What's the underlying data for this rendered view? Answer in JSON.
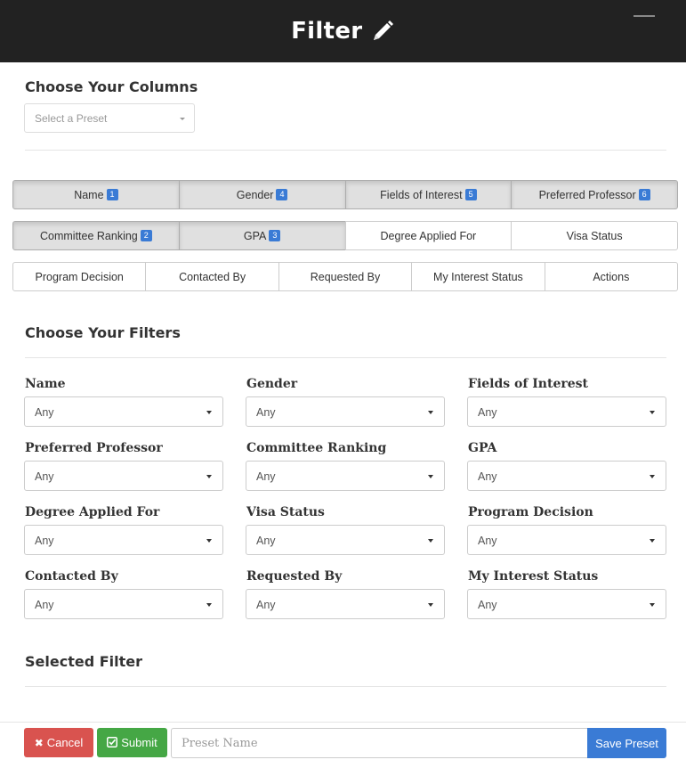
{
  "header": {
    "title": "Filter",
    "edit_icon": "pencil-icon",
    "menu_icon": "hamburger-icon"
  },
  "columns_section": {
    "title": "Choose Your Columns",
    "preset_select": {
      "placeholder": "Select a Preset"
    },
    "rows": [
      [
        {
          "label": "Name",
          "badge": "1",
          "active": true
        },
        {
          "label": "Gender",
          "badge": "4",
          "active": true
        },
        {
          "label": "Fields of Interest",
          "badge": "5",
          "active": true
        },
        {
          "label": "Preferred Professor",
          "badge": "6",
          "active": true
        }
      ],
      [
        {
          "label": "Committee Ranking",
          "badge": "2",
          "active": true
        },
        {
          "label": "GPA",
          "badge": "3",
          "active": true
        },
        {
          "label": "Degree Applied For",
          "badge": "",
          "active": false
        },
        {
          "label": "Visa Status",
          "badge": "",
          "active": false
        }
      ],
      [
        {
          "label": "Program Decision",
          "badge": "",
          "active": false
        },
        {
          "label": "Contacted By",
          "badge": "",
          "active": false
        },
        {
          "label": "Requested By",
          "badge": "",
          "active": false
        },
        {
          "label": "My Interest Status",
          "badge": "",
          "active": false
        },
        {
          "label": "Actions",
          "badge": "",
          "active": false
        }
      ]
    ]
  },
  "filters_section": {
    "title": "Choose Your Filters",
    "filters": [
      {
        "label": "Name",
        "value": "Any"
      },
      {
        "label": "Gender",
        "value": "Any"
      },
      {
        "label": "Fields of Interest",
        "value": "Any"
      },
      {
        "label": "Preferred Professor",
        "value": "Any"
      },
      {
        "label": "Committee Ranking",
        "value": "Any"
      },
      {
        "label": "GPA",
        "value": "Any"
      },
      {
        "label": "Degree Applied For",
        "value": "Any"
      },
      {
        "label": "Visa Status",
        "value": "Any"
      },
      {
        "label": "Program Decision",
        "value": "Any"
      },
      {
        "label": "Contacted By",
        "value": "Any"
      },
      {
        "label": "Requested By",
        "value": "Any"
      },
      {
        "label": "My Interest Status",
        "value": "Any"
      }
    ]
  },
  "selected_section": {
    "title": "Selected Filter"
  },
  "footer": {
    "cancel_label": "Cancel",
    "cancel_icon": "close-icon",
    "submit_label": "Submit",
    "submit_icon": "check-icon",
    "preset_name_placeholder": "Preset Name",
    "save_preset_label": "Save Preset"
  },
  "colors": {
    "header_bg": "#222222",
    "active_tab": "#e0e0e0",
    "badge": "#3a7bd5",
    "cancel": "#d9534f",
    "submit": "#45a745",
    "save": "#3a7bd5"
  }
}
